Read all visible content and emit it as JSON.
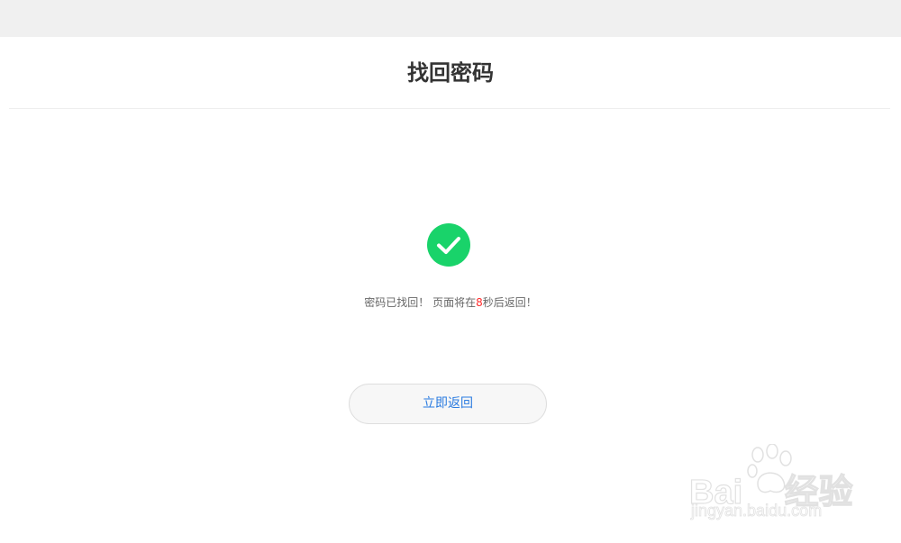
{
  "header": {
    "title": "找回密码"
  },
  "result": {
    "icon": "check-circle-icon",
    "icon_color": "#19d36a",
    "message_prefix": "密码已找回！ 页面将在",
    "countdown_seconds": "8",
    "message_suffix": "秒后返回！",
    "countdown_color": "#ff2b2b"
  },
  "actions": {
    "return_label": "立即返回",
    "return_color": "#2a7be0"
  },
  "watermark": {
    "logo_text": "Baidu经验",
    "site": "jingyan.baidu.com"
  }
}
